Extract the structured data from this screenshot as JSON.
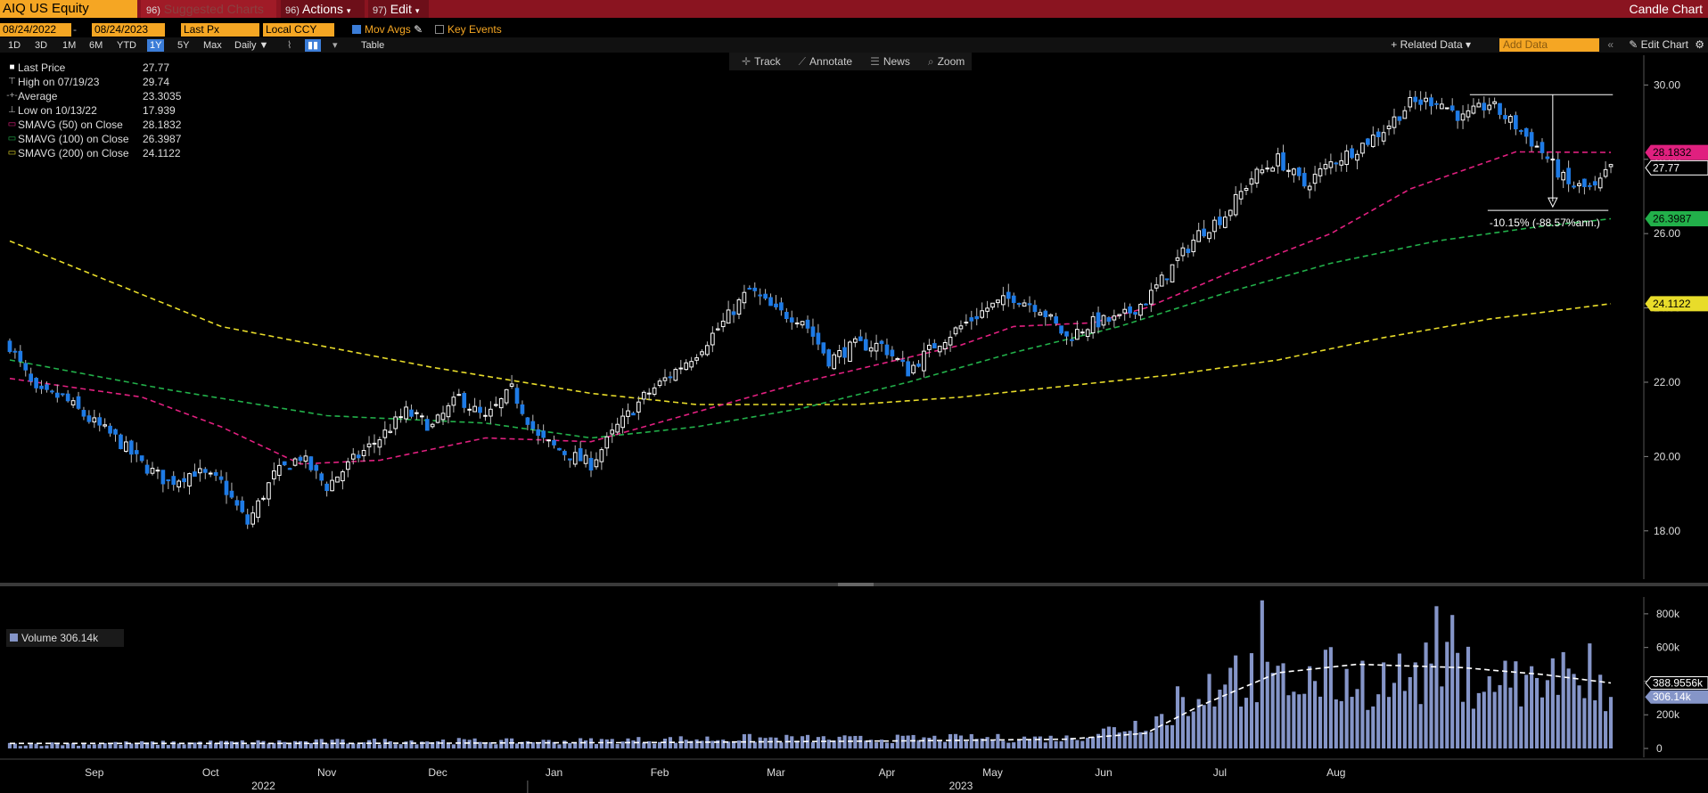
{
  "header": {
    "ticker": "AIQ US Equity",
    "suggested_num": "96)",
    "suggested_label": "Suggested Charts",
    "actions_num": "96)",
    "actions_label": "Actions",
    "edit_num": "97)",
    "edit_label": "Edit",
    "chart_type_title": "Candle Chart"
  },
  "controls": {
    "start_date": "08/24/2022",
    "end_date": "08/24/2023",
    "field": "Last Px",
    "currency": "Local CCY",
    "mov_avgs_label": "Mov Avgs",
    "key_events_label": "Key Events",
    "periods": [
      "1D",
      "3D",
      "1M",
      "6M",
      "YTD",
      "1Y",
      "5Y",
      "Max"
    ],
    "active_period": "1Y",
    "frequency": "Daily",
    "table_label": "Table",
    "related_data": "Related Data",
    "add_data_placeholder": "Add Data",
    "edit_chart": "Edit Chart"
  },
  "floatbar": {
    "track": "Track",
    "annotate": "Annotate",
    "news": "News",
    "zoom": "Zoom"
  },
  "colors": {
    "up": "#ffffff",
    "down": "#1e7be6",
    "sma50": "#e0207f",
    "sma100": "#22b04a",
    "sma200": "#e8dc2a",
    "volume": "#8595c8",
    "accent": "#f5a623",
    "titlebar": "#8a1420"
  },
  "legend": [
    {
      "mark": "square",
      "label": "Last Price",
      "value": "27.77"
    },
    {
      "mark": "high",
      "label": "High on 07/19/23",
      "value": "29.74"
    },
    {
      "mark": "avg",
      "label": "Average",
      "value": "23.3035"
    },
    {
      "mark": "low",
      "label": "Low on 10/13/22",
      "value": "17.939"
    },
    {
      "mark": "sma50",
      "label": "SMAVG (50)  on Close",
      "value": "28.1832"
    },
    {
      "mark": "sma100",
      "label": "SMAVG (100)  on Close",
      "value": "26.3987"
    },
    {
      "mark": "sma200",
      "label": "SMAVG (200)  on Close",
      "value": "24.1122"
    }
  ],
  "volume_legend": {
    "label": "Volume",
    "value": "306.14k"
  },
  "annotation": {
    "text": "-10.15% (-88.57%ann.)"
  },
  "chart_data": [
    {
      "type": "candlestick",
      "title": "",
      "y_ticks": [
        "30.00",
        "28.00",
        "26.00",
        "24.00",
        "22.00",
        "20.00",
        "18.00"
      ],
      "ylim": [
        16.7,
        30.8
      ],
      "x_months": [
        "Sep",
        "Oct",
        "Nov",
        "Dec",
        "Jan",
        "Feb",
        "Mar",
        "Apr",
        "May",
        "Jun",
        "Jul",
        "Aug"
      ],
      "x_years": [
        "2022",
        "2023"
      ],
      "price_tags": [
        {
          "value": 28.1832,
          "label": "28.1832",
          "color": "#e0207f"
        },
        {
          "value": 27.77,
          "label": "27.77",
          "color": "#ffffff"
        },
        {
          "value": 26.3987,
          "label": "26.3987",
          "color": "#22b04a"
        },
        {
          "value": 24.1122,
          "label": "24.1122",
          "color": "#e8dc2a"
        }
      ],
      "close_anchors": [
        [
          0,
          23.0
        ],
        [
          5,
          21.7
        ],
        [
          10,
          21.6
        ],
        [
          15,
          21.0
        ],
        [
          20,
          20.5
        ],
        [
          25,
          19.8
        ],
        [
          30,
          19.3
        ],
        [
          35,
          19.6
        ],
        [
          40,
          19.3
        ],
        [
          45,
          18.2
        ],
        [
          50,
          19.5
        ],
        [
          55,
          20.0
        ],
        [
          60,
          19.2
        ],
        [
          65,
          19.9
        ],
        [
          70,
          20.5
        ],
        [
          75,
          21.2
        ],
        [
          80,
          20.8
        ],
        [
          85,
          21.6
        ],
        [
          90,
          21.0
        ],
        [
          95,
          21.8
        ],
        [
          100,
          20.5
        ],
        [
          105,
          20.1
        ],
        [
          110,
          19.8
        ],
        [
          115,
          20.8
        ],
        [
          120,
          21.6
        ],
        [
          125,
          22.2
        ],
        [
          130,
          22.8
        ],
        [
          135,
          23.6
        ],
        [
          140,
          24.5
        ],
        [
          145,
          23.9
        ],
        [
          150,
          23.7
        ],
        [
          155,
          22.6
        ],
        [
          160,
          23.0
        ],
        [
          165,
          23.0
        ],
        [
          170,
          22.3
        ],
        [
          175,
          23.0
        ],
        [
          180,
          23.5
        ],
        [
          185,
          24.0
        ],
        [
          190,
          24.3
        ],
        [
          195,
          24.0
        ],
        [
          200,
          23.2
        ],
        [
          205,
          23.6
        ],
        [
          210,
          23.7
        ],
        [
          215,
          24.2
        ],
        [
          220,
          25.1
        ],
        [
          225,
          26.0
        ],
        [
          230,
          26.5
        ],
        [
          235,
          27.5
        ],
        [
          240,
          28.0
        ],
        [
          245,
          27.3
        ],
        [
          250,
          27.9
        ],
        [
          255,
          28.3
        ],
        [
          260,
          28.8
        ],
        [
          265,
          29.5
        ],
        [
          270,
          29.6
        ],
        [
          275,
          29.1
        ],
        [
          280,
          29.5
        ],
        [
          285,
          28.9
        ],
        [
          290,
          28.2
        ],
        [
          295,
          27.3
        ],
        [
          300,
          27.2
        ],
        [
          303,
          27.77
        ]
      ],
      "sma50_anchors": [
        [
          0,
          22.1
        ],
        [
          25,
          21.6
        ],
        [
          40,
          20.8
        ],
        [
          55,
          19.8
        ],
        [
          70,
          19.9
        ],
        [
          90,
          20.5
        ],
        [
          110,
          20.4
        ],
        [
          130,
          21.2
        ],
        [
          150,
          22.0
        ],
        [
          165,
          22.5
        ],
        [
          180,
          23.0
        ],
        [
          190,
          23.5
        ],
        [
          205,
          23.6
        ],
        [
          215,
          24.0
        ],
        [
          230,
          24.9
        ],
        [
          250,
          26.0
        ],
        [
          265,
          27.2
        ],
        [
          285,
          28.2
        ],
        [
          303,
          28.1832
        ]
      ],
      "sma100_anchors": [
        [
          0,
          22.6
        ],
        [
          30,
          21.8
        ],
        [
          60,
          21.1
        ],
        [
          90,
          20.9
        ],
        [
          110,
          20.5
        ],
        [
          130,
          20.8
        ],
        [
          150,
          21.3
        ],
        [
          170,
          22.0
        ],
        [
          190,
          22.8
        ],
        [
          210,
          23.5
        ],
        [
          230,
          24.4
        ],
        [
          250,
          25.2
        ],
        [
          270,
          25.8
        ],
        [
          290,
          26.2
        ],
        [
          303,
          26.3987
        ]
      ],
      "sma200_anchors": [
        [
          0,
          25.8
        ],
        [
          40,
          23.5
        ],
        [
          80,
          22.4
        ],
        [
          110,
          21.7
        ],
        [
          130,
          21.4
        ],
        [
          160,
          21.4
        ],
        [
          180,
          21.6
        ],
        [
          200,
          21.9
        ],
        [
          220,
          22.2
        ],
        [
          240,
          22.6
        ],
        [
          260,
          23.2
        ],
        [
          280,
          23.7
        ],
        [
          303,
          24.1122
        ]
      ],
      "measure": {
        "from_index": 278,
        "from_value": 29.74,
        "to_index": 295,
        "to_value": 26.72
      }
    },
    {
      "type": "bar",
      "title": "Volume",
      "y_ticks": [
        "800k",
        "600k",
        "400k",
        "200k",
        "0"
      ],
      "ylim": [
        0,
        900
      ],
      "last_value": "306.14k",
      "avg_label": "388.9556k",
      "avg_value": 389,
      "volume_anchors": [
        [
          0,
          25
        ],
        [
          20,
          30
        ],
        [
          40,
          35
        ],
        [
          60,
          40
        ],
        [
          80,
          45
        ],
        [
          100,
          40
        ],
        [
          120,
          50
        ],
        [
          140,
          60
        ],
        [
          160,
          55
        ],
        [
          180,
          60
        ],
        [
          200,
          60
        ],
        [
          210,
          120
        ],
        [
          220,
          200
        ],
        [
          230,
          450
        ],
        [
          240,
          380
        ],
        [
          250,
          420
        ],
        [
          260,
          400
        ],
        [
          270,
          450
        ],
        [
          280,
          420
        ],
        [
          290,
          380
        ],
        [
          303,
          306
        ]
      ],
      "avg_anchors": [
        [
          0,
          30
        ],
        [
          60,
          30
        ],
        [
          120,
          35
        ],
        [
          170,
          45
        ],
        [
          200,
          55
        ],
        [
          215,
          90
        ],
        [
          225,
          250
        ],
        [
          240,
          450
        ],
        [
          255,
          500
        ],
        [
          275,
          480
        ],
        [
          290,
          440
        ],
        [
          303,
          389
        ]
      ]
    }
  ]
}
